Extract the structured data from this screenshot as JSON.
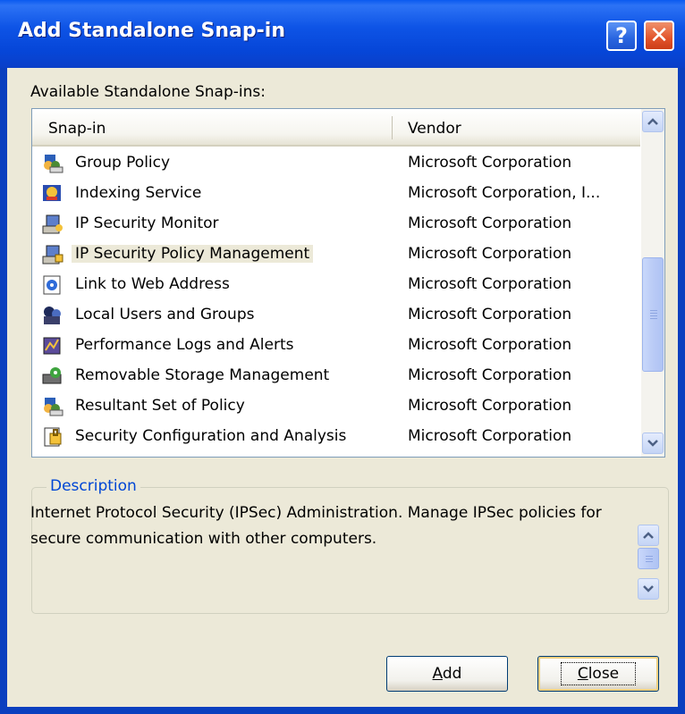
{
  "window": {
    "title": "Add Standalone Snap-in",
    "help_glyph": "?",
    "close_glyph": "✕"
  },
  "available_label": "Available Standalone Snap-ins:",
  "list": {
    "columns": {
      "snapin": "Snap-in",
      "vendor": "Vendor"
    },
    "rows": [
      {
        "name": "Group Policy",
        "vendor": "Microsoft Corporation",
        "icon": "group-policy-icon"
      },
      {
        "name": "Indexing Service",
        "vendor": "Microsoft Corporation, I...",
        "icon": "indexing-service-icon"
      },
      {
        "name": "IP Security Monitor",
        "vendor": "Microsoft Corporation",
        "icon": "ip-security-monitor-icon"
      },
      {
        "name": "IP Security Policy Management",
        "vendor": "Microsoft Corporation",
        "icon": "ip-security-policy-icon",
        "selected": true
      },
      {
        "name": "Link to Web Address",
        "vendor": "Microsoft Corporation",
        "icon": "web-link-icon"
      },
      {
        "name": "Local Users and Groups",
        "vendor": "Microsoft Corporation",
        "icon": "users-groups-icon"
      },
      {
        "name": "Performance Logs and Alerts",
        "vendor": "Microsoft Corporation",
        "icon": "performance-logs-icon"
      },
      {
        "name": "Removable Storage Management",
        "vendor": "Microsoft Corporation",
        "icon": "removable-storage-icon"
      },
      {
        "name": "Resultant Set of Policy",
        "vendor": "Microsoft Corporation",
        "icon": "resultant-set-policy-icon"
      },
      {
        "name": "Security Configuration and Analysis",
        "vendor": "Microsoft Corporation",
        "icon": "security-configuration-icon"
      }
    ]
  },
  "description": {
    "legend": "Description",
    "text": "Internet Protocol Security (IPSec) Administration. Manage IPSec policies for secure communication with other computers."
  },
  "buttons": {
    "add_first": "A",
    "add_rest": "dd",
    "close_first": "C",
    "close_rest": "lose"
  },
  "colors": {
    "titlebar": "#0A5AF0",
    "dialog_bg": "#ECE9D8",
    "legend": "#0046D5"
  }
}
